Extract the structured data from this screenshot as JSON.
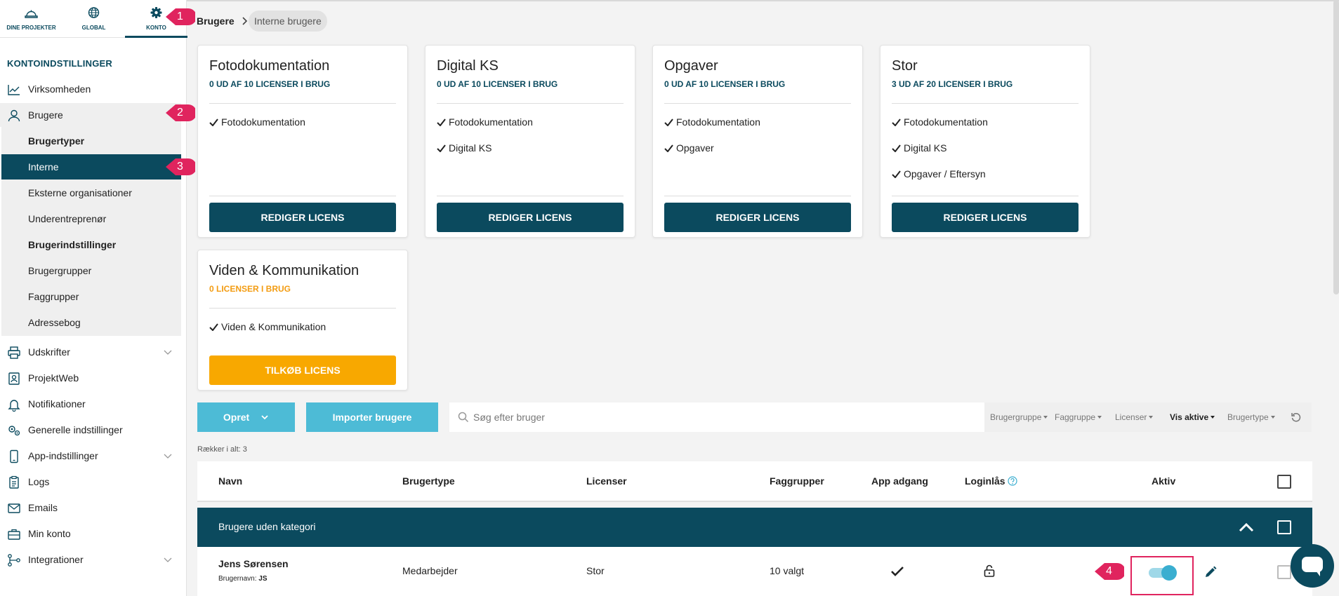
{
  "sidebar": {
    "tabs": [
      {
        "label": "DINE PROJEKTER",
        "icon": "helmet-icon"
      },
      {
        "label": "GLOBAL",
        "icon": "globe-icon"
      },
      {
        "label": "KONTO",
        "icon": "gear-icon"
      }
    ],
    "section_title": "KONTOINDSTILLINGER",
    "items": [
      {
        "label": "Virksomheden",
        "icon": "chart-icon"
      },
      {
        "label": "Brugere",
        "icon": "user-icon"
      },
      {
        "label": "Udskrifter",
        "icon": "printer-icon"
      },
      {
        "label": "ProjektWeb",
        "icon": "contact-card-icon"
      },
      {
        "label": "Notifikationer",
        "icon": "bell-icon"
      },
      {
        "label": "Generelle indstillinger",
        "icon": "gears-icon"
      },
      {
        "label": "App-indstillinger",
        "icon": "phone-icon"
      },
      {
        "label": "Logs",
        "icon": "clipboard-icon"
      },
      {
        "label": "Emails",
        "icon": "mail-icon"
      },
      {
        "label": "Min konto",
        "icon": "briefcase-icon"
      },
      {
        "label": "Integrationer",
        "icon": "network-icon"
      }
    ],
    "subitems": [
      {
        "label": "Brugertyper"
      },
      {
        "label": "Interne"
      },
      {
        "label": "Eksterne organisationer"
      },
      {
        "label": "Underentreprenør"
      },
      {
        "label": "Brugerindstillinger"
      },
      {
        "label": "Brugergrupper"
      },
      {
        "label": "Faggrupper"
      },
      {
        "label": "Adressebog"
      }
    ]
  },
  "annotations": {
    "b1": "1",
    "b2": "2",
    "b3": "3",
    "b4": "4"
  },
  "breadcrumb": {
    "root": "Brugere",
    "current": "Interne brugere"
  },
  "cards": [
    {
      "title": "Fotodokumentation",
      "sub": "0 UD AF 10 LICENSER I BRUG",
      "features": [
        "Fotodokumentation"
      ],
      "button": "REDIGER LICENS"
    },
    {
      "title": "Digital KS",
      "sub": "0 UD AF 10 LICENSER I BRUG",
      "features": [
        "Fotodokumentation",
        "Digital KS"
      ],
      "button": "REDIGER LICENS"
    },
    {
      "title": "Opgaver",
      "sub": "0 UD AF 10 LICENSER I BRUG",
      "features": [
        "Fotodokumentation",
        "Opgaver"
      ],
      "button": "REDIGER LICENS"
    },
    {
      "title": "Stor",
      "sub": "3 UD AF 20 LICENSER I BRUG",
      "features": [
        "Fotodokumentation",
        "Digital KS",
        "Opgaver / Eftersyn"
      ],
      "button": "REDIGER LICENS"
    },
    {
      "title": "Viden & Kommunikation",
      "sub": "0 LICENSER I BRUG",
      "features": [
        "Viden & Kommunikation"
      ],
      "button": "TILKØB LICENS"
    }
  ],
  "toolbar": {
    "create_label": "Opret",
    "import_label": "Importer brugere",
    "search_placeholder": "Søg efter bruger",
    "filters": [
      "Brugergruppe",
      "Faggruppe",
      "Licenser",
      "Vis aktive",
      "Brugertype"
    ]
  },
  "table": {
    "rows_count": "Rækker i alt: 3",
    "headers": [
      "Navn",
      "Brugertype",
      "Licenser",
      "Faggrupper",
      "App adgang",
      "Loginlås",
      "Aktiv"
    ],
    "group_label": "Brugere uden kategori",
    "rows": [
      {
        "name": "Jens Sørensen",
        "username_label": "Brugernavn:",
        "username": "JS",
        "type": "Medarbejder",
        "license": "Stor",
        "groups": "10 valgt"
      }
    ]
  },
  "colors": {
    "primary": "#0b4a5e",
    "accent": "#4dbbd6",
    "orange": "#f8a800",
    "annotation": "#e0245e"
  }
}
